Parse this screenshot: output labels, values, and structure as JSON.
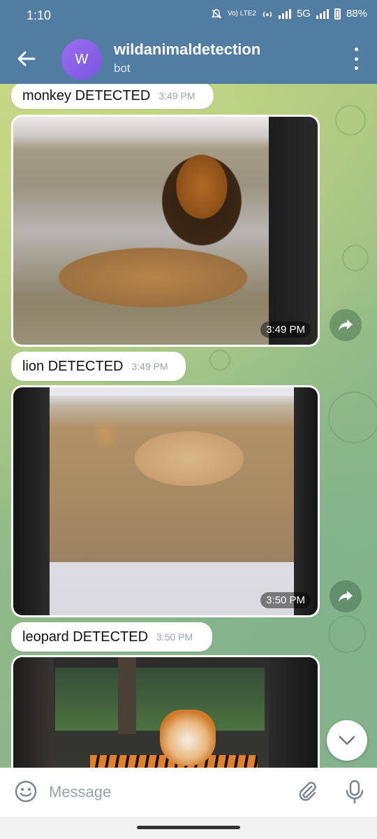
{
  "status_bar": {
    "time": "1:10",
    "network_label": "Vo) LTE2",
    "network_type": "5G",
    "battery": "88%"
  },
  "header": {
    "avatar_letter": "W",
    "title": "wildanimaldetection",
    "subtitle": "bot"
  },
  "messages": [
    {
      "type": "text",
      "text": "monkey DETECTED",
      "time": "3:49 PM"
    },
    {
      "type": "photo",
      "subject": "lion",
      "time": "3:49 PM"
    },
    {
      "type": "text",
      "text": "lion DETECTED",
      "time": "3:49 PM"
    },
    {
      "type": "photo",
      "subject": "cheetah",
      "time": "3:50 PM"
    },
    {
      "type": "text",
      "text": "leopard DETECTED",
      "time": "3:50 PM"
    },
    {
      "type": "photo",
      "subject": "tiger",
      "time": ""
    }
  ],
  "input": {
    "placeholder": "Message",
    "value": ""
  },
  "icons": {
    "back": "arrow-left-icon",
    "menu": "more-vert-icon",
    "share": "share-arrow-icon",
    "scroll_down": "chevron-down-icon",
    "emoji": "emoji-icon",
    "attach": "paperclip-icon",
    "mic": "microphone-icon"
  },
  "colors": {
    "header": "#527da3",
    "avatar": "#8a63ea",
    "bubble": "#ffffff",
    "time_text": "#9aa4ad"
  }
}
